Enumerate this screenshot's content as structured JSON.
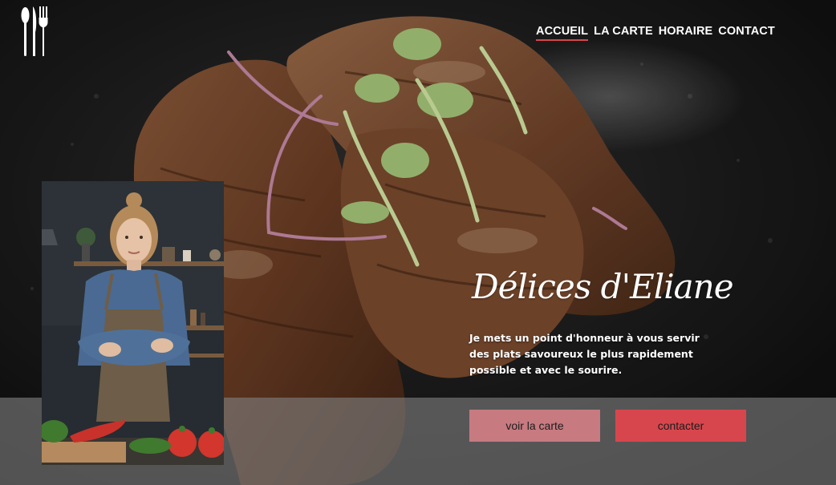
{
  "nav": {
    "items": [
      {
        "label": "ACCUEIL",
        "active": true
      },
      {
        "label": "LA CARTE",
        "active": false
      },
      {
        "label": "HORAIRE",
        "active": false
      },
      {
        "label": "CONTACT",
        "active": false
      }
    ]
  },
  "logo": {
    "icon": "cutlery-icon"
  },
  "hero": {
    "title": "Délices d'Eliane",
    "intro": "Je mets un point d'honneur à vous servir des plats savoureux le plus rapidement possible et avec le sourire."
  },
  "buttons": {
    "menu_label": "voir la carte",
    "contact_label": "contacter"
  },
  "colors": {
    "accent": "#d8464d",
    "accent_light": "#c77a80",
    "band": "#808080"
  }
}
